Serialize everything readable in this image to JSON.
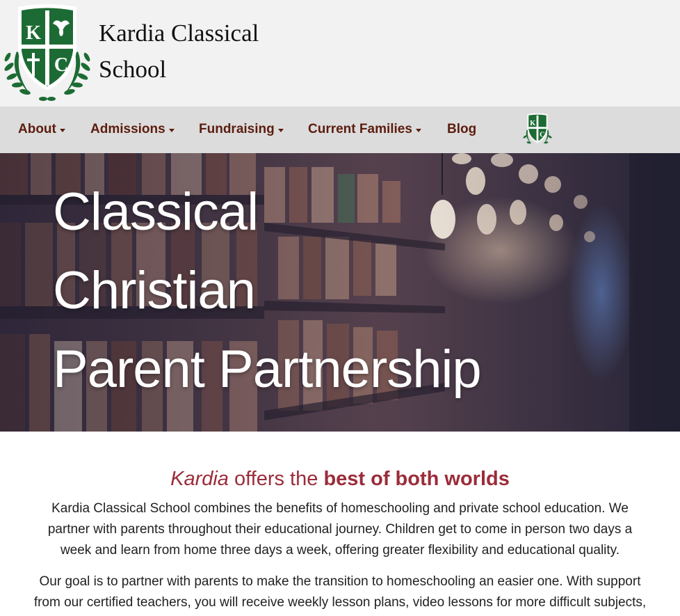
{
  "header": {
    "school_name_line1": "Kardia Classical",
    "school_name_line2": "School",
    "crest_letters": [
      "K",
      "C"
    ]
  },
  "nav": {
    "items": [
      {
        "label": "About",
        "dropdown": true
      },
      {
        "label": "Admissions",
        "dropdown": true
      },
      {
        "label": "Fundraising",
        "dropdown": true
      },
      {
        "label": "Current Families",
        "dropdown": true
      },
      {
        "label": "Blog",
        "dropdown": false
      }
    ]
  },
  "hero": {
    "lines": [
      "Classical",
      "Christian",
      "Parent Partnership"
    ]
  },
  "intro": {
    "heading_italic": "Kardia",
    "heading_middle": " offers the ",
    "heading_bold": "best of both worlds",
    "paragraph1_lines": [
      "Kardia Classical School combines the benefits of homeschooling and private school education. We",
      "partner with parents throughout their educational journey. Children get to come in person two days a",
      "week and learn from home three days a week, offering greater flexibility and educational quality."
    ],
    "paragraph2_lines": [
      "Our goal is to partner with parents to make the transition to homeschooling an easier one. With support",
      "from our certified teachers, you will receive weekly lesson plans, video lessons for more difficult subjects,"
    ]
  },
  "colors": {
    "header_bg": "#f2f2f2",
    "nav_bg": "#dcdcdc",
    "nav_text": "#5c1d0e",
    "crest_green": "#1d6b34",
    "heading_accent": "#9b2c3a"
  }
}
